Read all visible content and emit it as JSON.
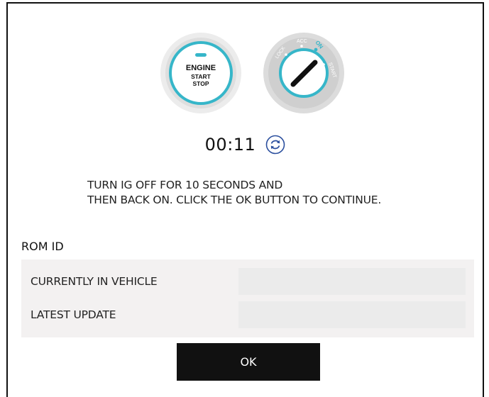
{
  "engine_button": {
    "line1": "ENGINE",
    "line2": "START",
    "line3": "STOP",
    "accent_color": "#36b6c9"
  },
  "ignition_switch": {
    "positions": [
      "LOCK",
      "ACC",
      "ON",
      "START"
    ],
    "active_position": "ON",
    "accent_color": "#36b6c9"
  },
  "timer": {
    "value": "00:11",
    "refresh_icon": "refresh-icon"
  },
  "instructions": {
    "line1": "TURN IG OFF FOR 10 SECONDS AND",
    "line2": "THEN BACK ON. CLICK THE OK BUTTON TO CONTINUE."
  },
  "rom": {
    "title": "ROM ID",
    "rows": [
      {
        "label": "CURRENTLY IN VEHICLE",
        "value": ""
      },
      {
        "label": "LATEST UPDATE",
        "value": ""
      }
    ]
  },
  "ok_button": {
    "label": "OK"
  }
}
